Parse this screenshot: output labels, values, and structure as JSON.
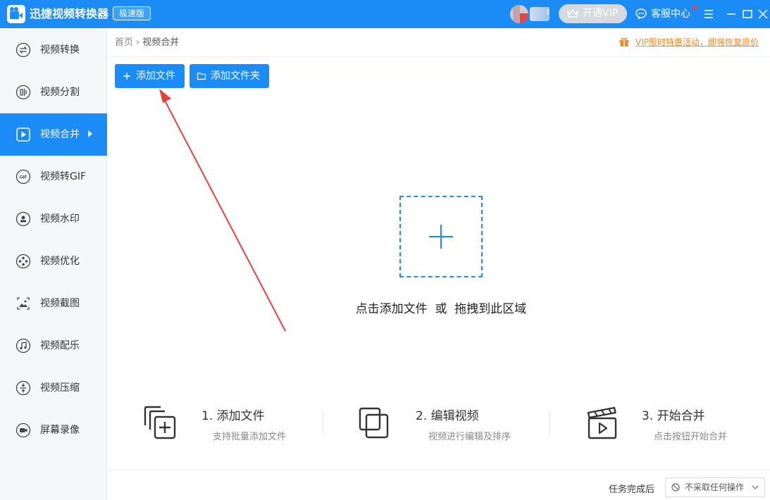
{
  "app": {
    "title": "迅捷视频转换器",
    "edition": "极速版",
    "user_suffix": "i",
    "vip_label": "开通VIP",
    "support_label": "客服中心"
  },
  "sidebar": {
    "items": [
      {
        "label": "视频转换",
        "icon": "convert-icon"
      },
      {
        "label": "视频分割",
        "icon": "split-icon"
      },
      {
        "label": "视频合并",
        "icon": "merge-icon",
        "active": true
      },
      {
        "label": "视频转GIF",
        "icon": "gif-icon"
      },
      {
        "label": "视频水印",
        "icon": "watermark-icon"
      },
      {
        "label": "视频优化",
        "icon": "optimize-icon"
      },
      {
        "label": "视频截图",
        "icon": "screenshot-icon"
      },
      {
        "label": "视频配乐",
        "icon": "music-icon"
      },
      {
        "label": "视频压缩",
        "icon": "compress-icon"
      },
      {
        "label": "屏幕录像",
        "icon": "record-icon"
      }
    ]
  },
  "breadcrumb": {
    "home": "首页",
    "separator": "›",
    "current": "视频合并"
  },
  "promo": {
    "text": "VIP限时特惠活动，即将恢复原价"
  },
  "toolbar": {
    "add_file": "添加文件",
    "add_folder": "添加文件夹"
  },
  "drop_zone": {
    "hint": "点击添加文件  或  拖拽到此区域"
  },
  "steps": [
    {
      "title": "1. 添加文件",
      "desc": "支持批量添加文件"
    },
    {
      "title": "2. 编辑视频",
      "desc": "视频进行编辑及排序"
    },
    {
      "title": "3. 开始合并",
      "desc": "点击按钮开始合并"
    }
  ],
  "footer": {
    "after_label": "任务完成后",
    "after_value": "不采取任何操作"
  },
  "colors": {
    "accent": "#1b8bf5",
    "promo": "#f08a24",
    "annotation_arrow": "#e8403d"
  }
}
